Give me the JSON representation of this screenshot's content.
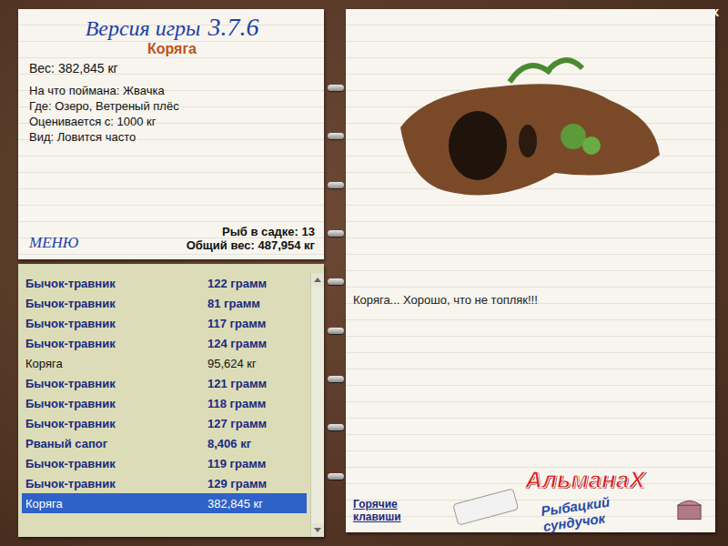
{
  "window": {
    "close": "x"
  },
  "info": {
    "version_label": "Версия игры",
    "version": "3.7.6",
    "name": "Коряга",
    "weight": "Вес: 382,845 кг",
    "details": [
      "На что поймана: Жвачка",
      "Где: Озеро, Ветреный плёс",
      "Оценивается с: 1000 кг",
      "Вид: Ловится часто"
    ],
    "menu": "МЕНЮ",
    "count": "Рыб в садке: 13",
    "total": "Общий вес: 487,954 кг"
  },
  "catch_list": [
    {
      "name": "Бычок-травник",
      "weight": "122 грамм",
      "kind": "fish",
      "selected": false
    },
    {
      "name": "Бычок-травник",
      "weight": "81 грамм",
      "kind": "fish",
      "selected": false
    },
    {
      "name": "Бычок-травник",
      "weight": "117 грамм",
      "kind": "fish",
      "selected": false
    },
    {
      "name": "Бычок-травник",
      "weight": "124 грамм",
      "kind": "fish",
      "selected": false
    },
    {
      "name": "Коряга",
      "weight": "95,624 кг",
      "kind": "junk",
      "selected": false
    },
    {
      "name": "Бычок-травник",
      "weight": "121 грамм",
      "kind": "fish",
      "selected": false
    },
    {
      "name": "Бычок-травник",
      "weight": "118 грамм",
      "kind": "fish",
      "selected": false
    },
    {
      "name": "Бычок-травник",
      "weight": "127 грамм",
      "kind": "fish",
      "selected": false
    },
    {
      "name": "Рваный сапог",
      "weight": "8,406 кг",
      "kind": "fish",
      "selected": false
    },
    {
      "name": "Бычок-травник",
      "weight": "119 грамм",
      "kind": "fish",
      "selected": false
    },
    {
      "name": "Бычок-травник",
      "weight": "129 грамм",
      "kind": "fish",
      "selected": false
    },
    {
      "name": "Коряга",
      "weight": "382,845 кг",
      "kind": "junk",
      "selected": true
    }
  ],
  "photo": {
    "caption": "Коряга... Хорошо, что не топляк!!!"
  },
  "hotkeys": "Горячие клавиши",
  "logo": {
    "title": "АльманаХ",
    "subtitle": "Рыбацкий сундучок"
  }
}
